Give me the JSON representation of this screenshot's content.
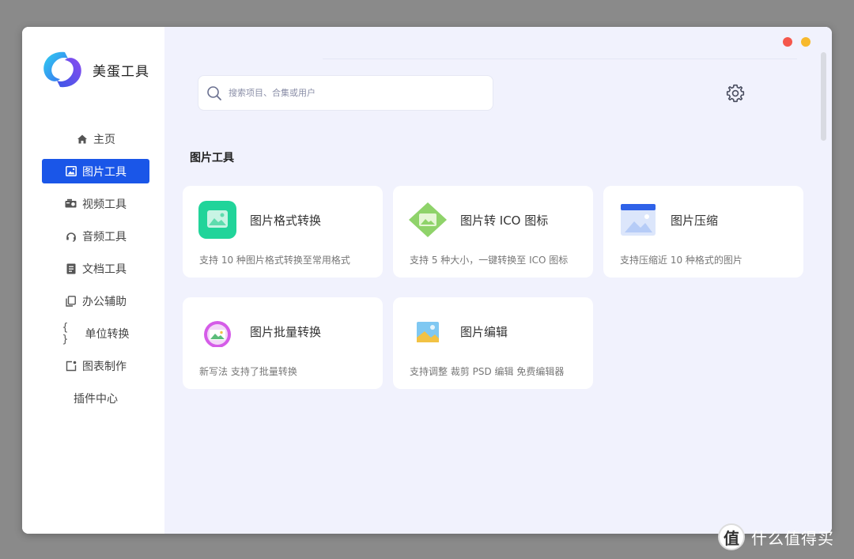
{
  "app": {
    "name": "美蛋工具"
  },
  "sidebar": {
    "items": [
      {
        "label": "主页",
        "icon": "home-icon",
        "active": false
      },
      {
        "label": "图片工具",
        "icon": "image-icon",
        "active": true
      },
      {
        "label": "视频工具",
        "icon": "video-icon",
        "active": false
      },
      {
        "label": "音频工具",
        "icon": "headphones-icon",
        "active": false
      },
      {
        "label": "文档工具",
        "icon": "document-icon",
        "active": false
      },
      {
        "label": "办公辅助",
        "icon": "copy-icon",
        "active": false
      },
      {
        "label": "单位转换",
        "icon": "braces-icon",
        "active": false
      },
      {
        "label": "图表制作",
        "icon": "chart-icon",
        "active": false
      },
      {
        "label": "插件中心",
        "icon": "",
        "active": false
      }
    ]
  },
  "search": {
    "placeholder": "搜索项目、合集或用户",
    "value": ""
  },
  "section": {
    "title": "图片工具"
  },
  "cards": [
    {
      "title": "图片格式转换",
      "desc": "支持 10 种图片格式转换至常用格式",
      "icon": "image-convert-icon"
    },
    {
      "title": "图片转 ICO 图标",
      "desc": "支持 5 种大小，一键转换至 ICO 图标",
      "icon": "ico-convert-icon"
    },
    {
      "title": "图片压缩",
      "desc": "支持压缩近 10 种格式的图片",
      "icon": "image-compress-icon"
    },
    {
      "title": "图片批量转换",
      "desc": "新写法 支持了批量转换",
      "icon": "batch-convert-icon"
    },
    {
      "title": "图片编辑",
      "desc": "支持调整 裁剪 PSD 编辑  免费编辑器",
      "icon": "image-edit-icon"
    }
  ],
  "watermark": {
    "logo": "值",
    "text": "什么值得买"
  },
  "colors": {
    "accent": "#1a56e8",
    "main_bg": "#f1f2fd",
    "close": "#f5574c",
    "minimize": "#f7b92d"
  }
}
